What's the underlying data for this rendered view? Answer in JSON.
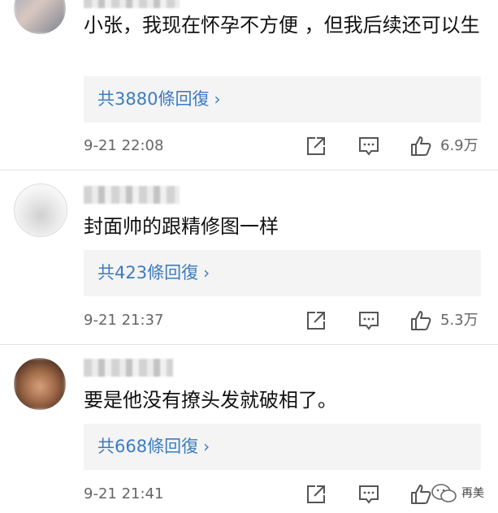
{
  "comments": [
    {
      "text": "小张，我现在怀孕不方便 ，但我后续还可以生",
      "replies_label": "共3880條回復",
      "time": "9-21 22:08",
      "likes": "6.9万"
    },
    {
      "text": "封面帅的跟精修图一样",
      "replies_label": "共423條回復",
      "time": "9-21 21:37",
      "likes": "5.3万"
    },
    {
      "text": "要是他没有撩头发就破相了。",
      "replies_label": "共668條回復",
      "time": "9-21 21:41",
      "likes": ""
    }
  ],
  "icons": {
    "share": "share-icon",
    "comment": "comment-icon",
    "like": "thumbs-up-icon",
    "chevron": "chevron-right-icon"
  },
  "watermark": {
    "text": "再美"
  },
  "colors": {
    "link": "#3b7cc2",
    "meta": "#666666",
    "reply_bg": "#f4f4f4"
  }
}
